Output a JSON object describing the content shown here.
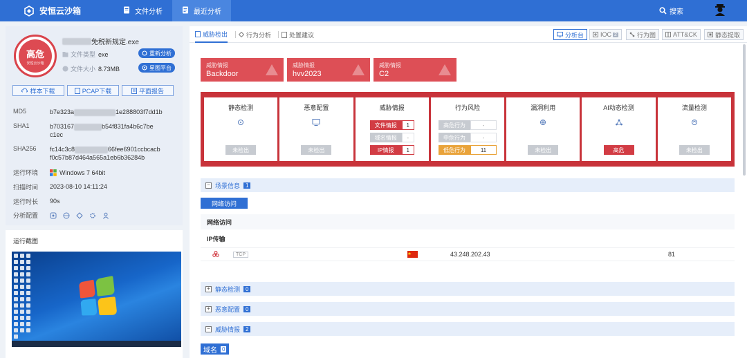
{
  "nav": {
    "brand": "安恒云沙箱",
    "items": [
      {
        "label": "文件分析",
        "icon": "file-icon"
      },
      {
        "label": "最近分析",
        "icon": "list-icon"
      }
    ],
    "search_label": "搜索"
  },
  "sample": {
    "verdict": "高危",
    "verdict_sub": "安恒云沙箱",
    "filename_suffix": "免税新规定.exe",
    "file_type_label": "文件类型",
    "file_type": "exe",
    "file_size_label": "文件大小",
    "file_size": "8.73MB",
    "reanalyze_label": "重新分析",
    "platform_label": "星图平台",
    "download_sample": "样本下载",
    "download_pcap": "PCAP下载",
    "report": "平面报告",
    "md5_label": "MD5",
    "md5_prefix": "b7e323a",
    "md5_suffix": "1e288803f7dd1b",
    "sha1_label": "SHA1",
    "sha1_prefix": "b703167",
    "sha1_suffix": "b54f831fa4b6c7be",
    "sha1_line2": "c1ec",
    "sha256_label": "SHA256",
    "sha256_prefix": "fc14c3c8",
    "sha256_suffix": "66fee6901ccbcacb",
    "sha256_line2": "f0c57b87d464a565a1eb6b36284b",
    "env_label": "运行环境",
    "env": "Windows 7 64bit",
    "scan_time_label": "扫描时间",
    "scan_time": "2023-08-10 14:11:24",
    "duration_label": "运行时长",
    "duration": "90s",
    "config_label": "分析配置"
  },
  "screenshot": {
    "title": "运行截图"
  },
  "tabs": [
    {
      "label": "威胁检出",
      "active": true
    },
    {
      "label": "行为分析",
      "active": false
    },
    {
      "label": "处置建议",
      "active": false
    }
  ],
  "tools": [
    {
      "label": "分析台",
      "active": true
    },
    {
      "label": "IOC",
      "count": "2"
    },
    {
      "label": "行为图"
    },
    {
      "label": "ATT&CK"
    },
    {
      "label": "静态提取"
    }
  ],
  "intel_cards": [
    {
      "title": "威胁情报",
      "value": "Backdoor"
    },
    {
      "title": "威胁情报",
      "value": "hvv2023"
    },
    {
      "title": "威胁情报",
      "value": "C2"
    }
  ],
  "detections": {
    "static": {
      "title": "静态检测",
      "status": "未检出"
    },
    "config": {
      "title": "恶意配置",
      "status": "未检出"
    },
    "intel": {
      "title": "威胁情报",
      "rows": [
        {
          "label": "文件情报",
          "value": "1"
        },
        {
          "label": "域名情报",
          "value": "-"
        },
        {
          "label": "IP情报",
          "value": "1"
        }
      ]
    },
    "behavior": {
      "title": "行为风险",
      "rows": [
        {
          "label": "高危行为",
          "value": "-"
        },
        {
          "label": "中危行为",
          "value": "-"
        },
        {
          "label": "低危行为",
          "value": "11"
        }
      ]
    },
    "exploit": {
      "title": "漏洞利用",
      "status": "未检出"
    },
    "ai": {
      "title": "AI动态检测",
      "status": "高危"
    },
    "traffic": {
      "title": "流量检测",
      "status": "未检出"
    }
  },
  "sections": {
    "scene": {
      "label": "场景信息",
      "count": "1"
    },
    "net_button": "网络访问",
    "net_title": "网络访问",
    "ip_title": "IP传输",
    "ip_row": {
      "protocol": "TCP",
      "ip": "43.248.202.43",
      "port": "81"
    },
    "static": {
      "label": "静态检测",
      "count": "0"
    },
    "config": {
      "label": "恶意配置",
      "count": "0"
    },
    "intel": {
      "label": "威胁情报",
      "count": "2"
    },
    "domain_button": "域名",
    "domain_count": "0"
  },
  "colors": {
    "brand": "#2f6fd4",
    "danger": "#dd4f56",
    "warning": "#e9a33a"
  }
}
